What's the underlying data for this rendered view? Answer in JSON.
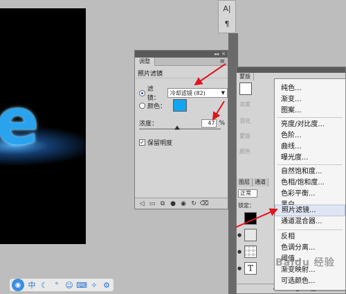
{
  "canvas": {
    "glyph": "e"
  },
  "tool_strip": {
    "icon1": "A|",
    "icon2": "¶"
  },
  "adjustments": {
    "tab_label": "调整",
    "panel_title": "照片滤镜",
    "filter_label": "滤镜：",
    "filter_value": "冷却滤镜 (82)",
    "color_label": "颜色：",
    "color_swatch": "#14a5f0",
    "density_label": "浓度：",
    "density_value": "47",
    "density_unit": "%",
    "density_level": 47,
    "preserve_label": "保留明度",
    "preserve_checked": true
  },
  "layers": {
    "tab_top": "蒙版",
    "faded_labels": [
      "浓度",
      "羽化",
      "蒙版",
      "颜色"
    ],
    "tabs": [
      "图层",
      "通道"
    ],
    "blend_mode": "正常",
    "lock_label": "锁定："
  },
  "context_menu": {
    "items": [
      "纯色...",
      "渐变...",
      "图案...",
      "亮度/对比度...",
      "色阶...",
      "曲线...",
      "曝光度...",
      "自然饱和度...",
      "色相/饱和度...",
      "色彩平衡...",
      "黑白...",
      "照片滤镜...",
      "通道混合器...",
      "反相",
      "色调分离...",
      "阈值...",
      "渐变映射...",
      "可选颜色..."
    ],
    "highlighted": "照片滤镜..."
  },
  "watermark": "Baidu 经验",
  "colors": {
    "arrow": "#e0141e",
    "accent": "#14a5f0"
  }
}
